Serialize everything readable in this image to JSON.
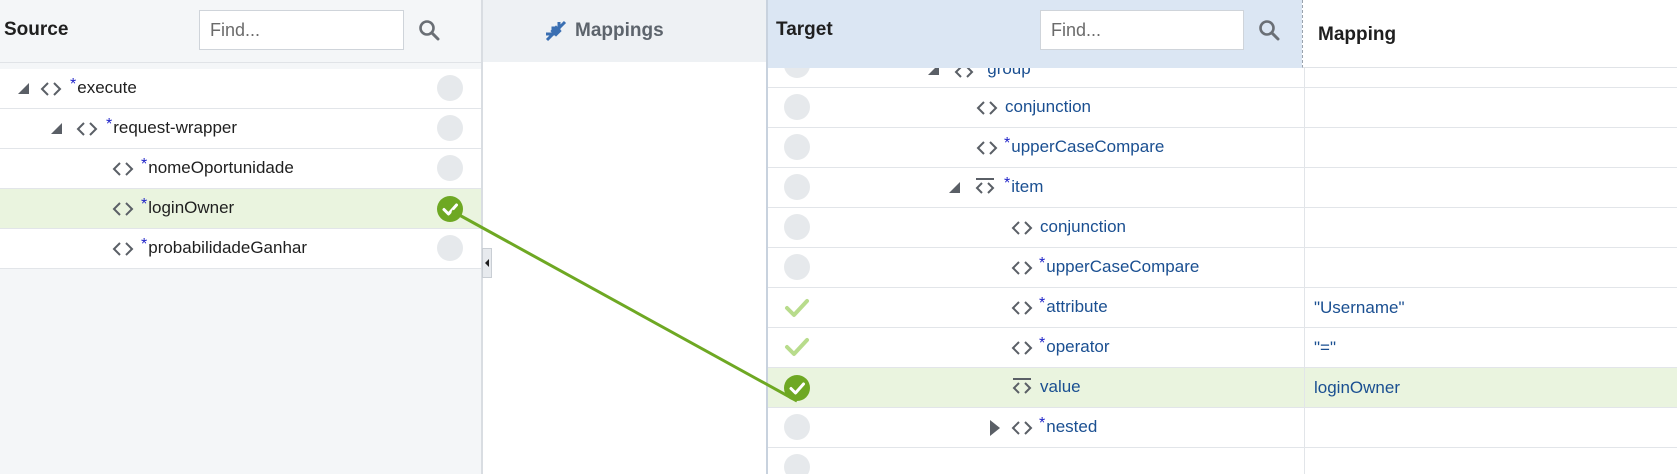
{
  "source": {
    "title": "Source",
    "search_placeholder": "Find...",
    "rows": [
      {
        "label": "execute",
        "required": "*",
        "status": "empty"
      },
      {
        "label": "request-wrapper",
        "required": "*",
        "status": "empty"
      },
      {
        "label": "nomeOportunidade",
        "required": "*",
        "status": "empty"
      },
      {
        "label": "loginOwner",
        "required": "*",
        "status": "mapped",
        "selected": true
      },
      {
        "label": "probabilidadeGanhar",
        "required": "*",
        "status": "empty"
      }
    ]
  },
  "mappings": {
    "title": "Mappings",
    "icon": "mapping-link-icon"
  },
  "target": {
    "title": "Target",
    "search_placeholder": "Find...",
    "mapping_column": "Mapping",
    "rows": [
      {
        "label": "group",
        "required": "*",
        "status": "empty",
        "mapping": ""
      },
      {
        "label": "conjunction",
        "required": "",
        "status": "empty",
        "mapping": ""
      },
      {
        "label": "upperCaseCompare",
        "required": "*",
        "status": "empty",
        "mapping": ""
      },
      {
        "label": "item",
        "required": "*",
        "status": "empty",
        "mapping": ""
      },
      {
        "label": "conjunction",
        "required": "",
        "status": "empty",
        "mapping": ""
      },
      {
        "label": "upperCaseCompare",
        "required": "*",
        "status": "empty",
        "mapping": ""
      },
      {
        "label": "attribute",
        "required": "*",
        "status": "literal",
        "mapping": "\"Username\""
      },
      {
        "label": "operator",
        "required": "*",
        "status": "literal",
        "mapping": "\"=\""
      },
      {
        "label": "value",
        "required": "",
        "status": "mapped",
        "mapping": "loginOwner",
        "selected": true
      },
      {
        "label": "nested",
        "required": "*",
        "status": "empty",
        "mapping": ""
      }
    ]
  },
  "colors": {
    "mapped_green": "#6ea823",
    "required_marker": "#1e22c8",
    "target_text": "#1a4f91",
    "target_header_bg": "#dbe6f3",
    "selected_row_bg": "#eaf4df"
  }
}
